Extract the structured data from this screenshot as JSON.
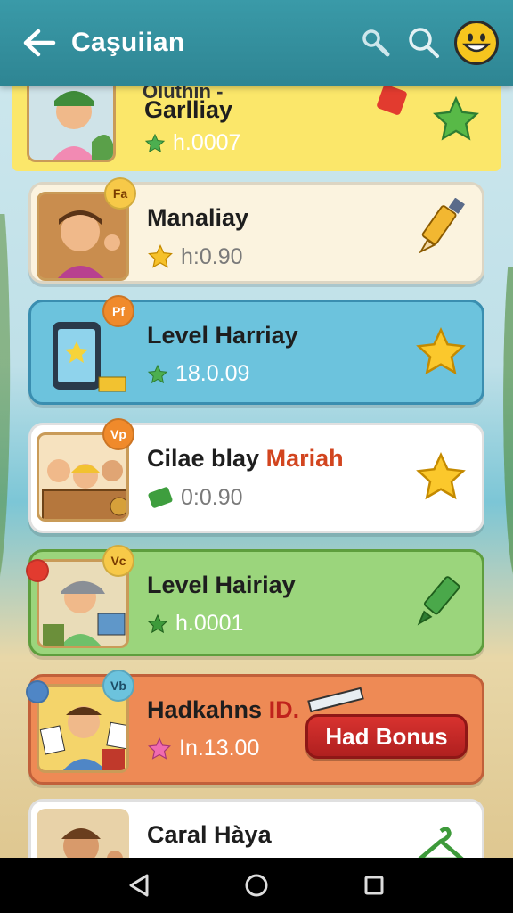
{
  "header": {
    "title": "Caşuiian",
    "back_icon": "arrow-left-icon",
    "icons": [
      "magnifier-icon",
      "search-icon",
      "smiley-avatar-icon"
    ],
    "bar_color": "#2e8593"
  },
  "list": {
    "items": [
      {
        "title": "Garlliay",
        "meta": "h.0007",
        "card_color": "#fbe76a",
        "meta_icon": "green-star-icon",
        "action_icon": "green-star-icon",
        "partial_heading": "Oluthin -"
      },
      {
        "title": "Manaliay",
        "meta": "h:0.90",
        "card_color": "#fbf3df",
        "meta_icon": "yellow-star-icon",
        "action_icon": "pencil-icon",
        "badge": "Fa"
      },
      {
        "title": "Level Harriay",
        "meta": "18.0.09",
        "card_color": "#6cc3dd",
        "meta_icon": "green-star-icon",
        "action_icon": "gold-star-icon",
        "badge": "Pf"
      },
      {
        "title": "Cilae blay",
        "title_accent": "Mariah",
        "meta": "0:0.90",
        "card_color": "#ffffff",
        "meta_icon": "green-ticket-icon",
        "action_icon": "gold-star-icon",
        "badge": "Vp"
      },
      {
        "title": "Level Hairiay",
        "meta": "h.0001",
        "card_color": "#9bd57c",
        "meta_icon": "green-star-icon",
        "action_icon": "green-pencil-icon",
        "badge": "Vc"
      },
      {
        "title": "Hadkahns",
        "title_accent": "ID.",
        "meta": "In.13.00",
        "card_color": "#ee8a55",
        "meta_icon": "pink-star-icon",
        "action_label": "Had Bonus",
        "badge": "Vb"
      },
      {
        "title": "Caral Hàya",
        "meta": "",
        "card_color": "#ffffff",
        "action_icon": "green-hanger-icon"
      }
    ]
  },
  "nav": {
    "icons": [
      "back-triangle-icon",
      "home-circle-icon",
      "recents-square-icon"
    ]
  }
}
